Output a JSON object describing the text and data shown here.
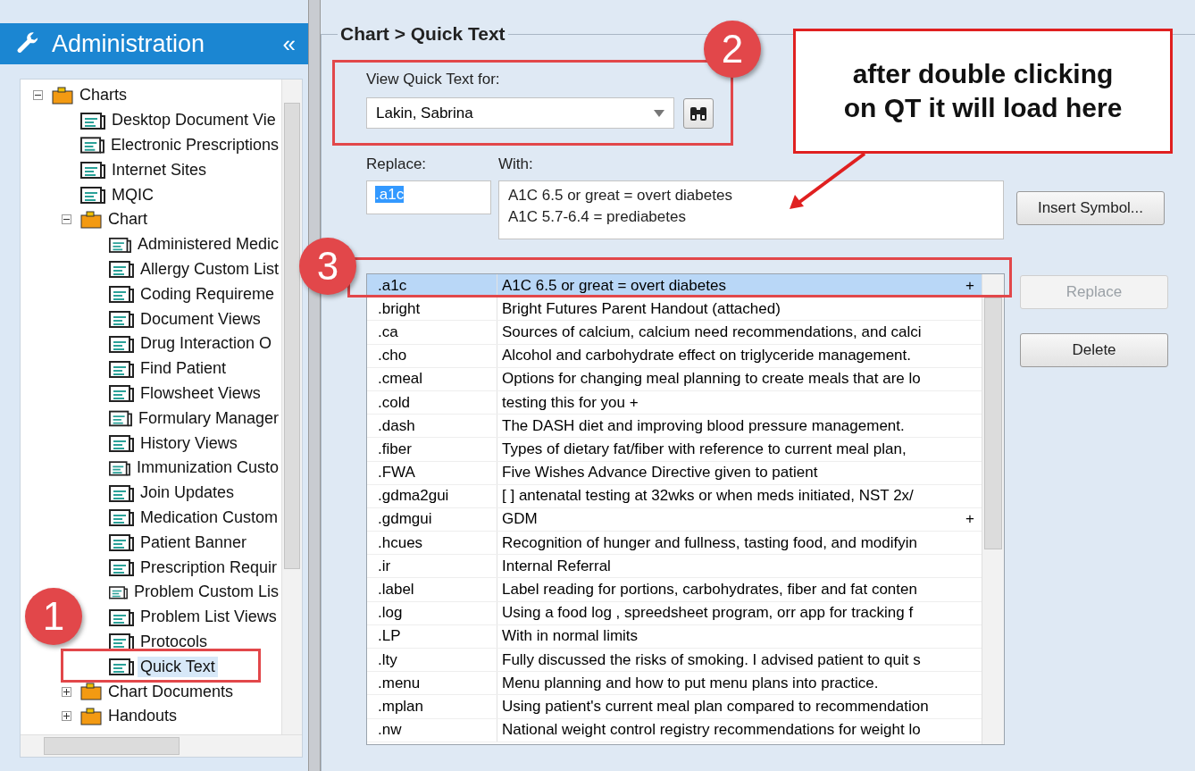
{
  "sidebar": {
    "title": "Administration",
    "collapse": "«",
    "tree": [
      {
        "kind": "folder",
        "label": "Charts",
        "expanded": true,
        "selected": false,
        "children": [
          {
            "kind": "document",
            "label": "Desktop Document Vie",
            "selected": false
          },
          {
            "kind": "document",
            "label": "Electronic Prescriptions",
            "selected": false
          },
          {
            "kind": "document",
            "label": "Internet Sites",
            "selected": false
          },
          {
            "kind": "document",
            "label": "MQIC",
            "selected": false
          },
          {
            "kind": "folder",
            "label": "Chart",
            "expanded": true,
            "selected": false,
            "children": [
              {
                "kind": "document",
                "label": "Administered Medic",
                "selected": false
              },
              {
                "kind": "document",
                "label": "Allergy Custom List",
                "selected": false
              },
              {
                "kind": "document",
                "label": "Coding Requireme",
                "selected": false
              },
              {
                "kind": "document",
                "label": "Document Views",
                "selected": false
              },
              {
                "kind": "document",
                "label": "Drug Interaction O",
                "selected": false
              },
              {
                "kind": "document",
                "label": "Find Patient",
                "selected": false
              },
              {
                "kind": "document",
                "label": "Flowsheet Views",
                "selected": false
              },
              {
                "kind": "document",
                "label": "Formulary Manager",
                "selected": false
              },
              {
                "kind": "document",
                "label": "History Views",
                "selected": false
              },
              {
                "kind": "document",
                "label": "Immunization Custo",
                "selected": false
              },
              {
                "kind": "document",
                "label": "Join Updates",
                "selected": false
              },
              {
                "kind": "document",
                "label": "Medication Custom",
                "selected": false
              },
              {
                "kind": "document",
                "label": "Patient Banner",
                "selected": false
              },
              {
                "kind": "document",
                "label": "Prescription Requir",
                "selected": false
              },
              {
                "kind": "document",
                "label": "Problem Custom Lis",
                "selected": false
              },
              {
                "kind": "document",
                "label": "Problem List Views",
                "selected": false
              },
              {
                "kind": "document",
                "label": "Protocols",
                "selected": false
              },
              {
                "kind": "document",
                "label": "Quick Text",
                "selected": true
              }
            ]
          },
          {
            "kind": "folder",
            "label": "Chart Documents",
            "expanded": false,
            "selected": false
          },
          {
            "kind": "folder",
            "label": "Handouts",
            "expanded": false,
            "selected": false
          }
        ]
      }
    ]
  },
  "panel": {
    "title": "Chart > Quick Text",
    "view_for": {
      "label": "View Quick Text for:",
      "value": "Lakin, Sabrina"
    },
    "replace": {
      "label": "Replace:",
      "value": ".a1c"
    },
    "with": {
      "label": "With:",
      "lines": [
        "A1C 6.5 or great = overt diabetes",
        "A1C 5.7-6.4 = prediabetes"
      ]
    },
    "buttons": [
      {
        "label": "Insert Symbol...",
        "disabled": false
      },
      {
        "label": "Replace",
        "disabled": true
      },
      {
        "label": "Delete",
        "disabled": false
      }
    ],
    "table": {
      "rows": [
        {
          "key": ".a1c",
          "text": "A1C 6.5 or great = overt diabetes",
          "mark": "+",
          "selected": true
        },
        {
          "key": ".bright",
          "text": "Bright Futures Parent Handout (attached)",
          "selected": false
        },
        {
          "key": ".ca",
          "text": "Sources of calcium, calcium need recommendations, and calci",
          "selected": false
        },
        {
          "key": ".cho",
          "text": "Alcohol and carbohydrate effect on triglyceride management.",
          "selected": false
        },
        {
          "key": ".cmeal",
          "text": "Options for changing meal planning to create meals that are lo",
          "selected": false
        },
        {
          "key": ".cold",
          "text": "testing this for you +",
          "selected": false
        },
        {
          "key": ".dash",
          "text": "The DASH diet and improving blood pressure management.",
          "selected": false
        },
        {
          "key": ".fiber",
          "text": "Types of dietary fat/fiber with reference to current meal plan,",
          "selected": false
        },
        {
          "key": ".FWA",
          "text": "Five Wishes Advance Directive given to patient",
          "selected": false
        },
        {
          "key": ".gdma2gui",
          "text": "[ ] antenatal testing at 32wks or when meds initiated, NST 2x/",
          "selected": false
        },
        {
          "key": ".gdmgui",
          "text": "GDM",
          "mark": "+",
          "selected": false
        },
        {
          "key": ".hcues",
          "text": "Recognition of hunger and fullness, tasting food, and modifyin",
          "selected": false
        },
        {
          "key": ".ir",
          "text": "Internal Referral",
          "selected": false
        },
        {
          "key": ".label",
          "text": "Label reading for portions, carbohydrates, fiber and fat conten",
          "selected": false
        },
        {
          "key": ".log",
          "text": "Using a food log , spreedsheet program, orr app for tracking f",
          "selected": false
        },
        {
          "key": ".LP",
          "text": "With in normal limits",
          "selected": false
        },
        {
          "key": ".lty",
          "text": "Fully discussed the risks of smoking. I advised patient to quit s",
          "selected": false
        },
        {
          "key": ".menu",
          "text": "Menu planning and how to put menu plans into practice.",
          "selected": false
        },
        {
          "key": ".mplan",
          "text": "Using patient's current meal plan compared to recommendation",
          "selected": false
        },
        {
          "key": ".nw",
          "text": "National weight control registry recommendations for weight lo",
          "selected": false
        }
      ]
    }
  },
  "annotations": {
    "markers": [
      "1",
      "2",
      "3"
    ],
    "callout": {
      "lines": [
        "after double clicking",
        "on QT it will load here"
      ]
    }
  }
}
